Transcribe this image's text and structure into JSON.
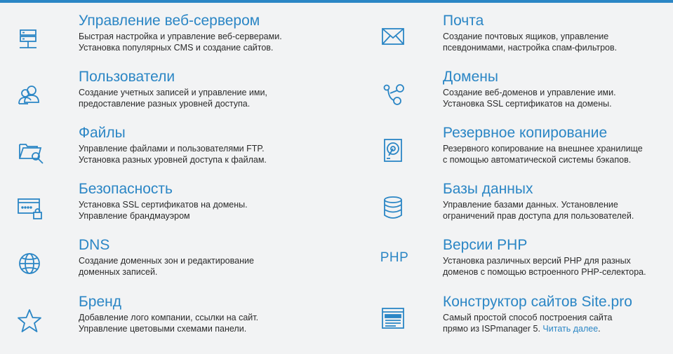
{
  "features": [
    {
      "title": "Управление веб-сервером",
      "line1": "Быстрая настройка и управление веб-серверами.",
      "line2": "Установка популярных CMS и создание сайтов.",
      "icon": "server-icon"
    },
    {
      "title": "Почта",
      "line1": "Создание почтовых ящиков, управление",
      "line2": "псевдонимами, настройка спам-фильтров.",
      "icon": "mail-icon"
    },
    {
      "title": "Пользователи",
      "line1": "Создание учетных записей и управление ими,",
      "line2": "предоставление разных уровней доступа.",
      "icon": "users-icon"
    },
    {
      "title": "Домены",
      "line1": "Создание веб-доменов и управление ими.",
      "line2": "Установка SSL сертификатов на домены.",
      "icon": "domains-icon"
    },
    {
      "title": "Файлы",
      "line1": "Управление файлами и пользователями FTP.",
      "line2": "Установка разных уровней доступа к файлам.",
      "icon": "folder-search-icon"
    },
    {
      "title": "Резервное копирование",
      "line1": "Резервного копирование на внешнее хранилище",
      "line2": "с помощью автоматической системы бэкапов.",
      "icon": "backup-icon"
    },
    {
      "title": "Безопасность",
      "line1": "Установка SSL сертификатов на домены.",
      "line2": "Управление брандмауэром",
      "icon": "security-lock-icon"
    },
    {
      "title": "Базы данных",
      "line1": "Управление базами данных. Установление",
      "line2": "ограничений прав доступа для пользователей.",
      "icon": "database-icon"
    },
    {
      "title": "DNS",
      "line1": "Создание доменных зон и редактирование",
      "line2": "доменных записей.",
      "icon": "globe-icon"
    },
    {
      "title": "Версии PHP",
      "line1": "Установка различных версий PHP для разных",
      "line2": "доменов с помощью встроенного PHP-селектора.",
      "icon": "php-icon",
      "icon_text": "PHP"
    },
    {
      "title": "Бренд",
      "line1": "Добавление лого компании, ссылки на сайт.",
      "line2": "Управление цветовыми схемами панели.",
      "icon": "star-icon"
    },
    {
      "title": "Конструктор сайтов Site.pro",
      "line1": "Самый простой способ построения сайта",
      "line2": "прямо из ISPmanager 5.",
      "link": "Читать далее",
      "link_suffix": ".",
      "icon": "site-builder-icon"
    }
  ],
  "colors": {
    "accent": "#2b86c5",
    "text": "#2b2b2b",
    "background": "#f2f3f4"
  }
}
